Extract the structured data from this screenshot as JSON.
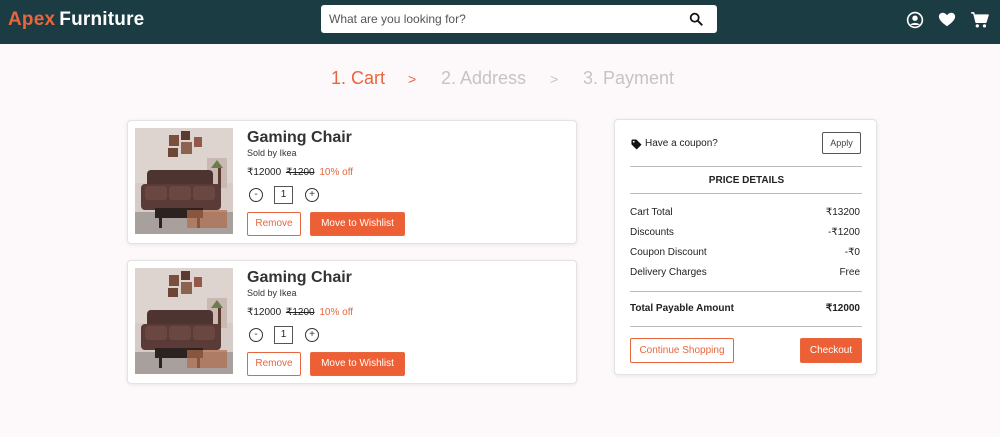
{
  "brand": {
    "accent": "Apex",
    "rest": "Furniture"
  },
  "search": {
    "placeholder": "What are you looking for?"
  },
  "steps": {
    "cart": "1. Cart",
    "address": "2. Address",
    "payment": "3. Payment",
    "separator": ">"
  },
  "cart_items": [
    {
      "name": "Gaming Chair",
      "seller": "Sold by Ikea",
      "price": "₹12000",
      "original_price": "₹1200",
      "discount": "10% off",
      "quantity": "1",
      "minus_label": "-",
      "plus_label": "+",
      "remove_label": "Remove",
      "wishlist_label": "Move to Wishlist"
    },
    {
      "name": "Gaming Chair",
      "seller": "Sold by Ikea",
      "price": "₹12000",
      "original_price": "₹1200",
      "discount": "10% off",
      "quantity": "1",
      "minus_label": "-",
      "plus_label": "+",
      "remove_label": "Remove",
      "wishlist_label": "Move to Wishlist"
    }
  ],
  "summary": {
    "coupon_text": "Have a coupon?",
    "apply_label": "Apply",
    "price_details_title": "PRICE DETAILS",
    "rows": [
      {
        "label": "Cart Total",
        "value": "₹13200"
      },
      {
        "label": "Discounts",
        "value": "-₹1200"
      },
      {
        "label": "Coupon Discount",
        "value": "-₹0"
      },
      {
        "label": "Delivery Charges",
        "value": "Free"
      }
    ],
    "total_label": "Total Payable Amount",
    "total_value": "₹12000",
    "continue_label": "Continue Shopping",
    "checkout_label": "Checkout"
  },
  "icons": {
    "search": "search-icon",
    "account": "user-circle-icon",
    "wishlist": "heart-icon",
    "cart": "shopping-cart-icon",
    "coupon": "tag-icon"
  },
  "colors": {
    "navbar": "#1b3c42",
    "accent": "#e8663d",
    "button_fill": "#ed5f34",
    "inactive_step": "#c4c4c4",
    "page_background": "#fdf8f9"
  }
}
